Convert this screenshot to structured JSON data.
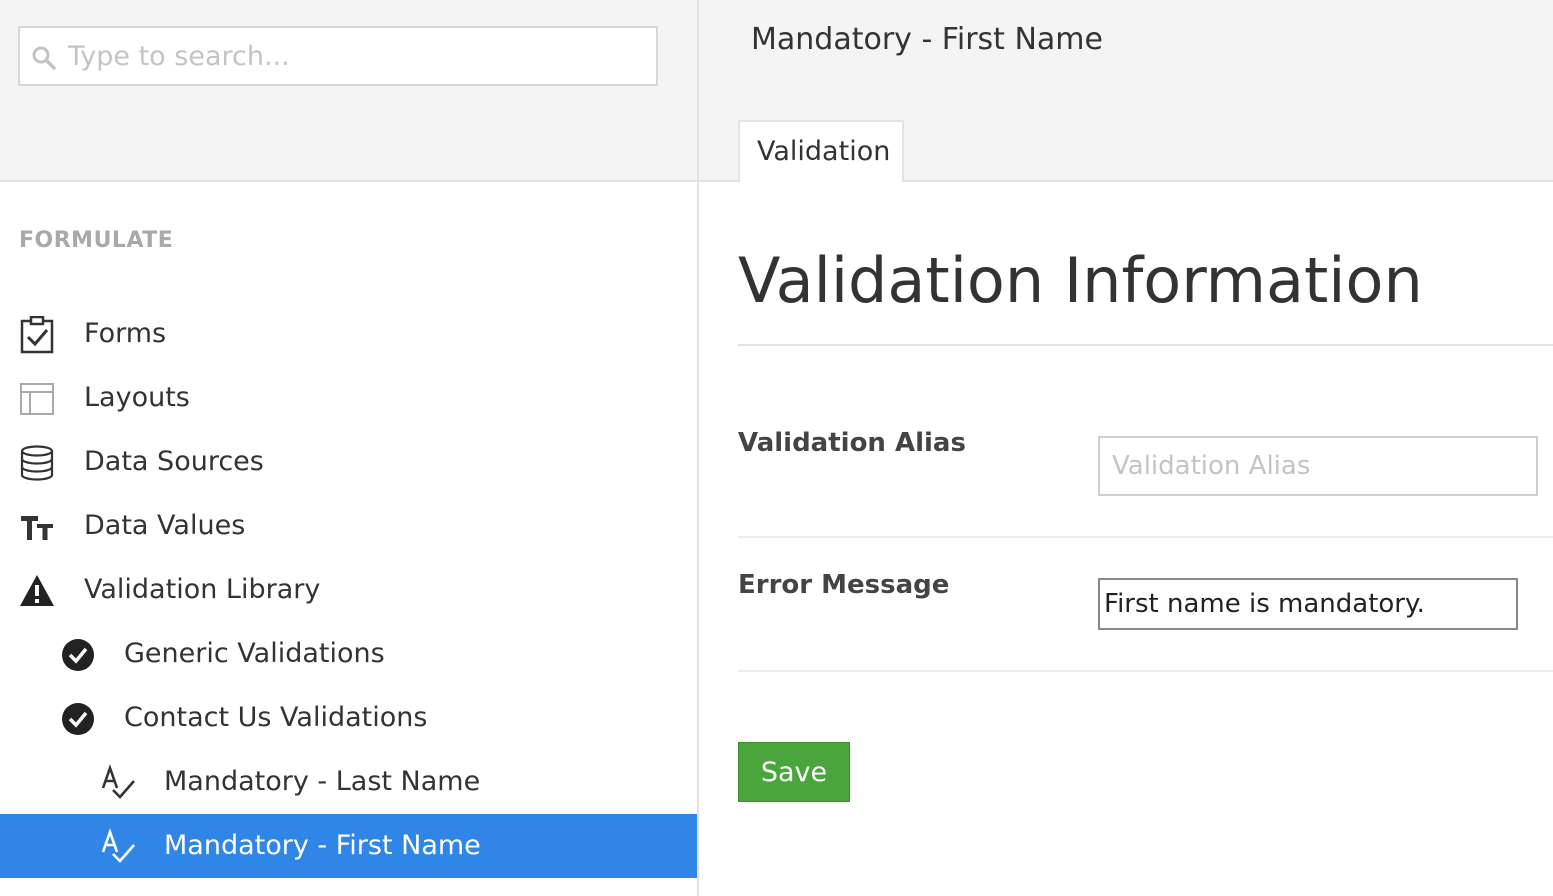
{
  "search": {
    "placeholder": "Type to search..."
  },
  "sidebar": {
    "section_heading": "FORMULATE",
    "items": [
      {
        "label": "Forms",
        "icon": "clipboard-check-icon"
      },
      {
        "label": "Layouts",
        "icon": "layout-icon"
      },
      {
        "label": "Data Sources",
        "icon": "database-icon"
      },
      {
        "label": "Data Values",
        "icon": "text-size-icon"
      },
      {
        "label": "Validation Library",
        "icon": "warning-icon"
      },
      {
        "label": "Generic Validations",
        "icon": "check-circle-icon"
      },
      {
        "label": "Contact Us Validations",
        "icon": "check-circle-icon"
      },
      {
        "label": "Mandatory - Last Name",
        "icon": "spellcheck-icon"
      },
      {
        "label": "Mandatory - First Name",
        "icon": "spellcheck-icon",
        "selected": true
      }
    ]
  },
  "header": {
    "node_title": "Mandatory - First Name",
    "tabs": [
      {
        "label": "Validation"
      }
    ]
  },
  "main": {
    "title": "Validation Information",
    "fields": {
      "alias": {
        "label": "Validation Alias",
        "placeholder": "Validation Alias",
        "value": ""
      },
      "error_message": {
        "label": "Error Message",
        "value": "First name is mandatory."
      }
    },
    "save_label": "Save"
  },
  "colors": {
    "selected_bg": "#2f86e6",
    "save_button": "#4aa63c",
    "panel_bg": "#f4f4f4"
  }
}
